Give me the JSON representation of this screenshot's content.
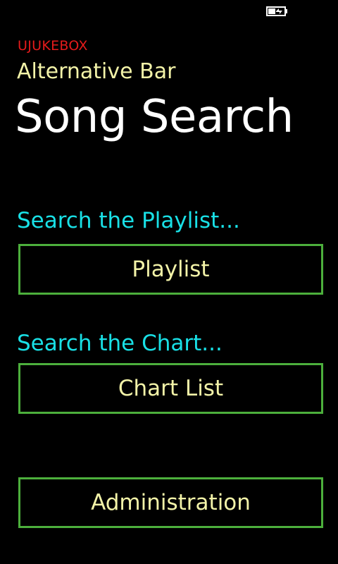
{
  "status_bar": {
    "battery_icon": "battery-charging-icon"
  },
  "header": {
    "app_name": "UJUKEBOX",
    "venue": "Alternative Bar",
    "page_title": "Song Search"
  },
  "sections": {
    "playlist": {
      "label": "Search the Playlist...",
      "button": "Playlist"
    },
    "chart": {
      "label": "Search the Chart...",
      "button": "Chart List"
    },
    "admin": {
      "button": "Administration"
    }
  },
  "colors": {
    "background": "#000000",
    "app_name": "#e51b1b",
    "accent_text": "#f3f3a8",
    "section_label": "#19e0e6",
    "button_border": "#4caf3c",
    "title": "#ffffff"
  }
}
